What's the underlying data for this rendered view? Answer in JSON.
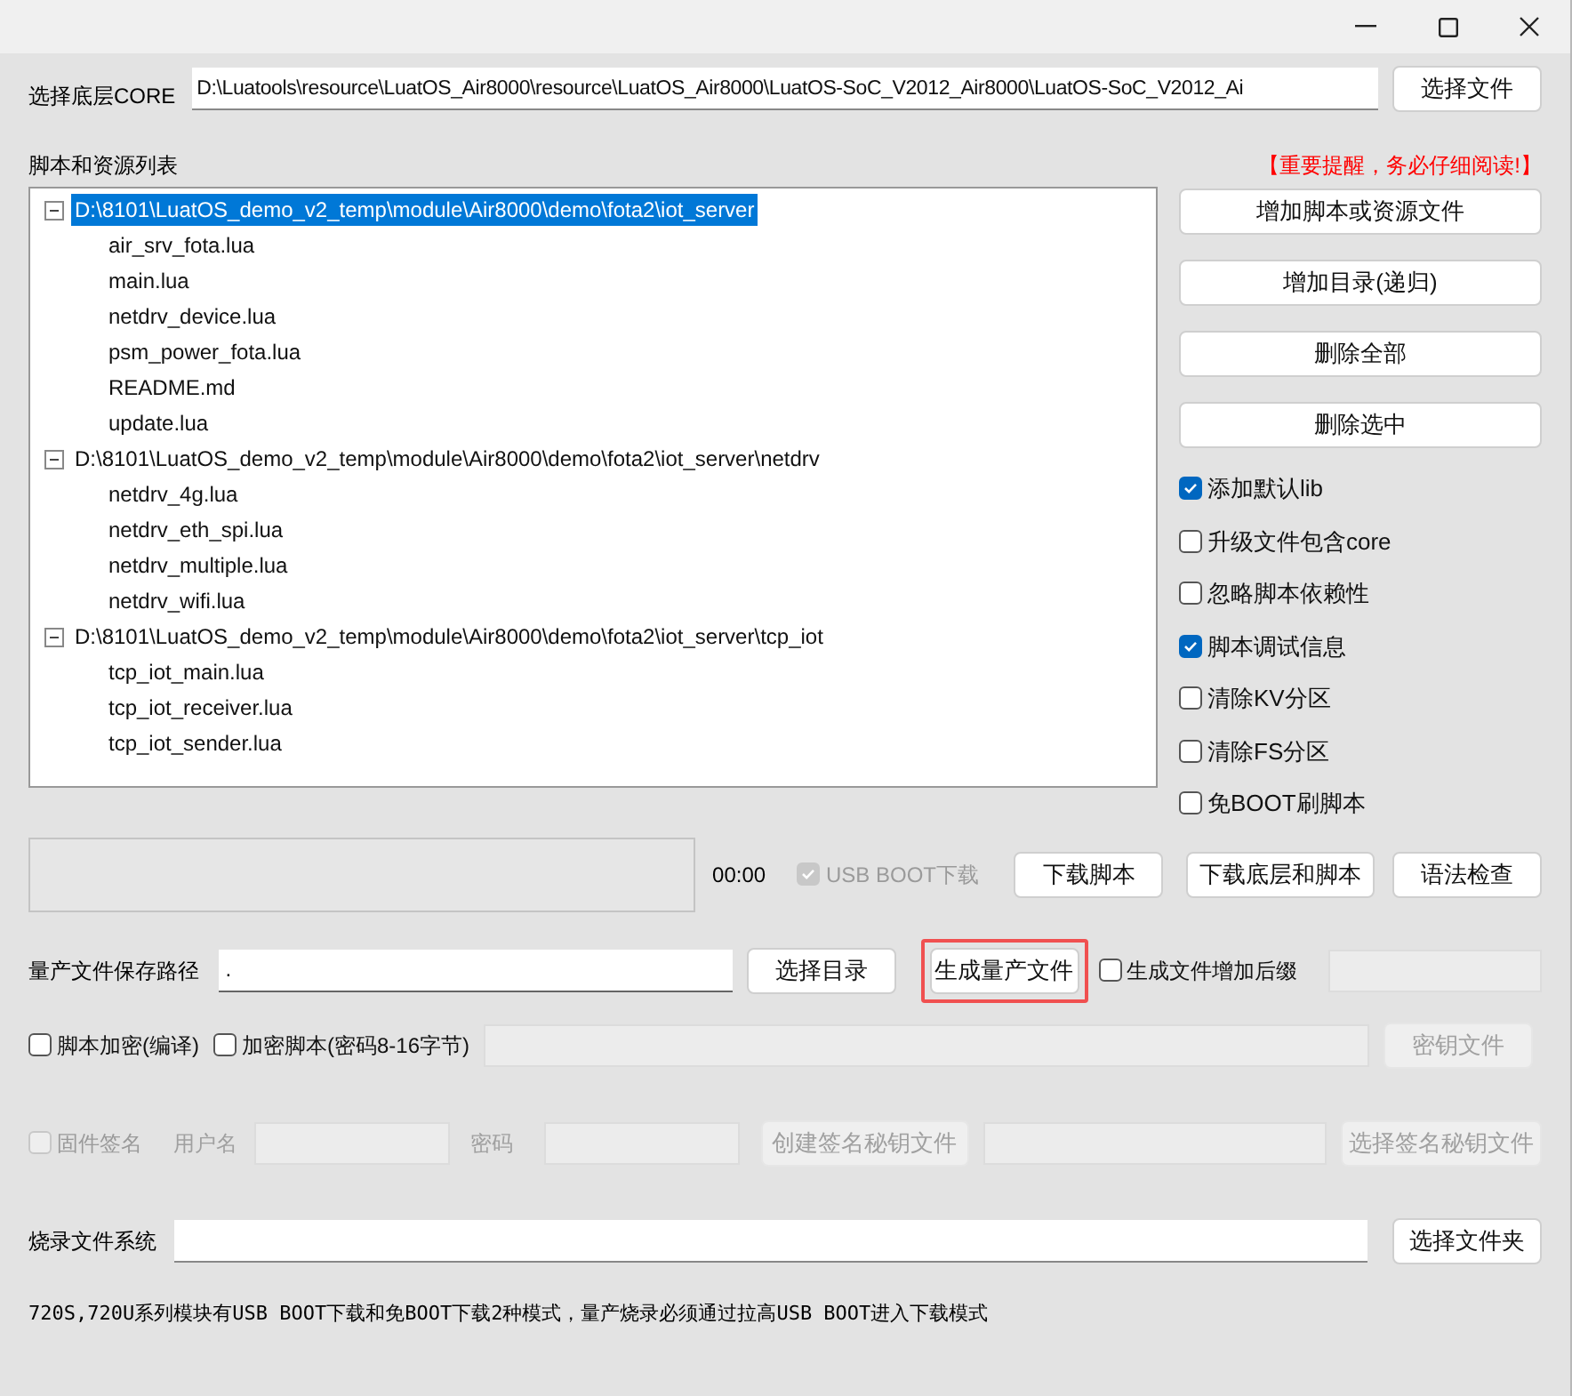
{
  "core": {
    "label": "选择底层CORE",
    "value": "D:\\Luatools\\resource\\LuatOS_Air8000\\resource\\LuatOS_Air8000\\LuatOS-SoC_V2012_Air8000\\LuatOS-SoC_V2012_Ai",
    "button": "选择文件"
  },
  "list_header": {
    "label": "脚本和资源列表",
    "warning": "【重要提醒，务必仔细阅读!】"
  },
  "tree": [
    {
      "label": "D:\\8101\\LuatOS_demo_v2_temp\\module\\Air8000\\demo\\fota2\\iot_server",
      "expanded": true,
      "selected": true,
      "children": [
        {
          "label": "air_srv_fota.lua"
        },
        {
          "label": "main.lua"
        },
        {
          "label": "netdrv_device.lua"
        },
        {
          "label": "psm_power_fota.lua"
        },
        {
          "label": "README.md"
        },
        {
          "label": "update.lua"
        }
      ]
    },
    {
      "label": "D:\\8101\\LuatOS_demo_v2_temp\\module\\Air8000\\demo\\fota2\\iot_server\\netdrv",
      "expanded": true,
      "selected": false,
      "children": [
        {
          "label": "netdrv_4g.lua"
        },
        {
          "label": "netdrv_eth_spi.lua"
        },
        {
          "label": "netdrv_multiple.lua"
        },
        {
          "label": "netdrv_wifi.lua"
        }
      ]
    },
    {
      "label": "D:\\8101\\LuatOS_demo_v2_temp\\module\\Air8000\\demo\\fota2\\iot_server\\tcp_iot",
      "expanded": true,
      "selected": false,
      "children": [
        {
          "label": "tcp_iot_main.lua"
        },
        {
          "label": "tcp_iot_receiver.lua"
        },
        {
          "label": "tcp_iot_sender.lua"
        }
      ]
    }
  ],
  "side_buttons": [
    "增加脚本或资源文件",
    "增加目录(递归)",
    "删除全部",
    "删除选中"
  ],
  "options": [
    {
      "label": "添加默认lib",
      "checked": true
    },
    {
      "label": "升级文件包含core",
      "checked": false
    },
    {
      "label": "忽略脚本依赖性",
      "checked": false
    },
    {
      "label": "脚本调试信息",
      "checked": true
    },
    {
      "label": "清除KV分区",
      "checked": false
    },
    {
      "label": "清除FS分区",
      "checked": false
    },
    {
      "label": "免BOOT刷脚本",
      "checked": false
    }
  ],
  "download": {
    "time": "00:00",
    "usb_boot": {
      "label": "USB BOOT下载",
      "checked": true,
      "disabled": true
    },
    "buttons": [
      "下载脚本",
      "下载底层和脚本",
      "语法检查"
    ]
  },
  "production": {
    "label": "量产文件保存路径",
    "value": ".",
    "select_button": "选择目录",
    "generate_button": {
      "label": "生成量产文件",
      "highlighted": true
    },
    "suffix": {
      "label": "生成文件增加后缀",
      "checked": false
    }
  },
  "encryption": {
    "options": [
      {
        "label": "脚本加密(编译)",
        "checked": false
      },
      {
        "label": "加密脚本(密码8-16字节)",
        "checked": false
      }
    ],
    "key_button": {
      "label": "密钥文件",
      "disabled": true
    }
  },
  "signing": {
    "checkbox": {
      "label": "固件签名",
      "checked": false,
      "disabled": true
    },
    "username_label": "用户名",
    "password_label": "密码",
    "create_button": "创建签名秘钥文件",
    "select_button": "选择签名秘钥文件",
    "disabled": true
  },
  "filesystem": {
    "label": "烧录文件系统",
    "button": "选择文件夹"
  },
  "note": "720S,720U系列模块有USB BOOT下载和免BOOT下载2种模式，量产烧录必须通过拉高USB BOOT进入下载模式"
}
